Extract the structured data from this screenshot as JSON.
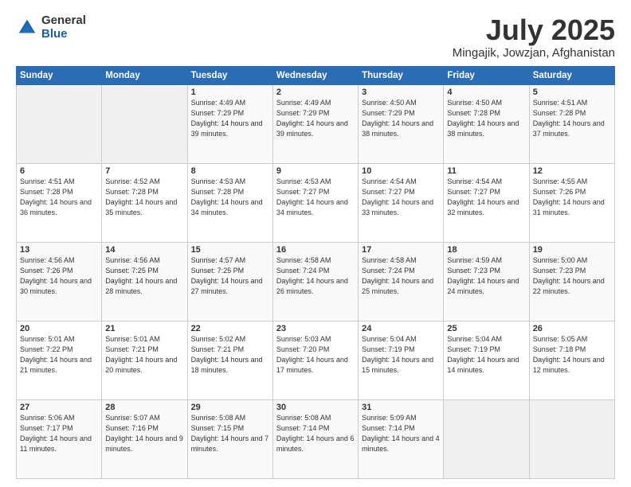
{
  "logo": {
    "general": "General",
    "blue": "Blue"
  },
  "title": {
    "month_year": "July 2025",
    "location": "Mingajik, Jowzjan, Afghanistan"
  },
  "weekdays": [
    "Sunday",
    "Monday",
    "Tuesday",
    "Wednesday",
    "Thursday",
    "Friday",
    "Saturday"
  ],
  "weeks": [
    [
      {
        "day": "",
        "sunrise": "",
        "sunset": "",
        "daylight": ""
      },
      {
        "day": "",
        "sunrise": "",
        "sunset": "",
        "daylight": ""
      },
      {
        "day": "1",
        "sunrise": "Sunrise: 4:49 AM",
        "sunset": "Sunset: 7:29 PM",
        "daylight": "Daylight: 14 hours and 39 minutes."
      },
      {
        "day": "2",
        "sunrise": "Sunrise: 4:49 AM",
        "sunset": "Sunset: 7:29 PM",
        "daylight": "Daylight: 14 hours and 39 minutes."
      },
      {
        "day": "3",
        "sunrise": "Sunrise: 4:50 AM",
        "sunset": "Sunset: 7:29 PM",
        "daylight": "Daylight: 14 hours and 38 minutes."
      },
      {
        "day": "4",
        "sunrise": "Sunrise: 4:50 AM",
        "sunset": "Sunset: 7:28 PM",
        "daylight": "Daylight: 14 hours and 38 minutes."
      },
      {
        "day": "5",
        "sunrise": "Sunrise: 4:51 AM",
        "sunset": "Sunset: 7:28 PM",
        "daylight": "Daylight: 14 hours and 37 minutes."
      }
    ],
    [
      {
        "day": "6",
        "sunrise": "Sunrise: 4:51 AM",
        "sunset": "Sunset: 7:28 PM",
        "daylight": "Daylight: 14 hours and 36 minutes."
      },
      {
        "day": "7",
        "sunrise": "Sunrise: 4:52 AM",
        "sunset": "Sunset: 7:28 PM",
        "daylight": "Daylight: 14 hours and 35 minutes."
      },
      {
        "day": "8",
        "sunrise": "Sunrise: 4:53 AM",
        "sunset": "Sunset: 7:28 PM",
        "daylight": "Daylight: 14 hours and 34 minutes."
      },
      {
        "day": "9",
        "sunrise": "Sunrise: 4:53 AM",
        "sunset": "Sunset: 7:27 PM",
        "daylight": "Daylight: 14 hours and 34 minutes."
      },
      {
        "day": "10",
        "sunrise": "Sunrise: 4:54 AM",
        "sunset": "Sunset: 7:27 PM",
        "daylight": "Daylight: 14 hours and 33 minutes."
      },
      {
        "day": "11",
        "sunrise": "Sunrise: 4:54 AM",
        "sunset": "Sunset: 7:27 PM",
        "daylight": "Daylight: 14 hours and 32 minutes."
      },
      {
        "day": "12",
        "sunrise": "Sunrise: 4:55 AM",
        "sunset": "Sunset: 7:26 PM",
        "daylight": "Daylight: 14 hours and 31 minutes."
      }
    ],
    [
      {
        "day": "13",
        "sunrise": "Sunrise: 4:56 AM",
        "sunset": "Sunset: 7:26 PM",
        "daylight": "Daylight: 14 hours and 30 minutes."
      },
      {
        "day": "14",
        "sunrise": "Sunrise: 4:56 AM",
        "sunset": "Sunset: 7:25 PM",
        "daylight": "Daylight: 14 hours and 28 minutes."
      },
      {
        "day": "15",
        "sunrise": "Sunrise: 4:57 AM",
        "sunset": "Sunset: 7:25 PM",
        "daylight": "Daylight: 14 hours and 27 minutes."
      },
      {
        "day": "16",
        "sunrise": "Sunrise: 4:58 AM",
        "sunset": "Sunset: 7:24 PM",
        "daylight": "Daylight: 14 hours and 26 minutes."
      },
      {
        "day": "17",
        "sunrise": "Sunrise: 4:58 AM",
        "sunset": "Sunset: 7:24 PM",
        "daylight": "Daylight: 14 hours and 25 minutes."
      },
      {
        "day": "18",
        "sunrise": "Sunrise: 4:59 AM",
        "sunset": "Sunset: 7:23 PM",
        "daylight": "Daylight: 14 hours and 24 minutes."
      },
      {
        "day": "19",
        "sunrise": "Sunrise: 5:00 AM",
        "sunset": "Sunset: 7:23 PM",
        "daylight": "Daylight: 14 hours and 22 minutes."
      }
    ],
    [
      {
        "day": "20",
        "sunrise": "Sunrise: 5:01 AM",
        "sunset": "Sunset: 7:22 PM",
        "daylight": "Daylight: 14 hours and 21 minutes."
      },
      {
        "day": "21",
        "sunrise": "Sunrise: 5:01 AM",
        "sunset": "Sunset: 7:21 PM",
        "daylight": "Daylight: 14 hours and 20 minutes."
      },
      {
        "day": "22",
        "sunrise": "Sunrise: 5:02 AM",
        "sunset": "Sunset: 7:21 PM",
        "daylight": "Daylight: 14 hours and 18 minutes."
      },
      {
        "day": "23",
        "sunrise": "Sunrise: 5:03 AM",
        "sunset": "Sunset: 7:20 PM",
        "daylight": "Daylight: 14 hours and 17 minutes."
      },
      {
        "day": "24",
        "sunrise": "Sunrise: 5:04 AM",
        "sunset": "Sunset: 7:19 PM",
        "daylight": "Daylight: 14 hours and 15 minutes."
      },
      {
        "day": "25",
        "sunrise": "Sunrise: 5:04 AM",
        "sunset": "Sunset: 7:19 PM",
        "daylight": "Daylight: 14 hours and 14 minutes."
      },
      {
        "day": "26",
        "sunrise": "Sunrise: 5:05 AM",
        "sunset": "Sunset: 7:18 PM",
        "daylight": "Daylight: 14 hours and 12 minutes."
      }
    ],
    [
      {
        "day": "27",
        "sunrise": "Sunrise: 5:06 AM",
        "sunset": "Sunset: 7:17 PM",
        "daylight": "Daylight: 14 hours and 11 minutes."
      },
      {
        "day": "28",
        "sunrise": "Sunrise: 5:07 AM",
        "sunset": "Sunset: 7:16 PM",
        "daylight": "Daylight: 14 hours and 9 minutes."
      },
      {
        "day": "29",
        "sunrise": "Sunrise: 5:08 AM",
        "sunset": "Sunset: 7:15 PM",
        "daylight": "Daylight: 14 hours and 7 minutes."
      },
      {
        "day": "30",
        "sunrise": "Sunrise: 5:08 AM",
        "sunset": "Sunset: 7:14 PM",
        "daylight": "Daylight: 14 hours and 6 minutes."
      },
      {
        "day": "31",
        "sunrise": "Sunrise: 5:09 AM",
        "sunset": "Sunset: 7:14 PM",
        "daylight": "Daylight: 14 hours and 4 minutes."
      },
      {
        "day": "",
        "sunrise": "",
        "sunset": "",
        "daylight": ""
      },
      {
        "day": "",
        "sunrise": "",
        "sunset": "",
        "daylight": ""
      }
    ]
  ]
}
